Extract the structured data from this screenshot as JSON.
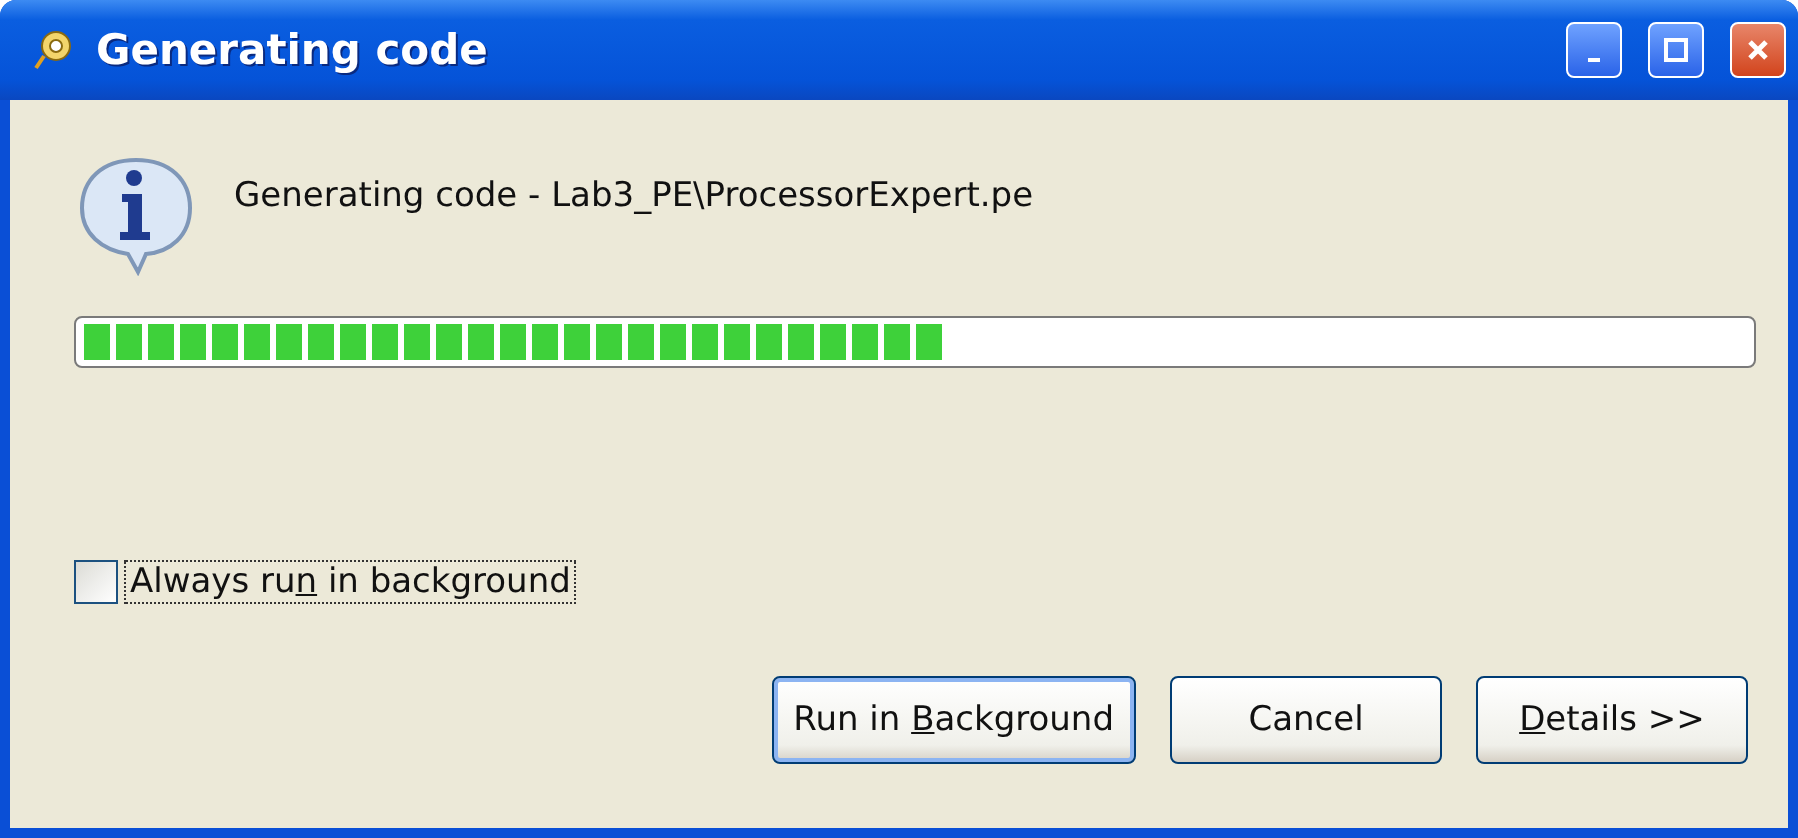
{
  "window": {
    "title": "Generating code"
  },
  "message": "Generating code - Lab3_PE\\ProcessorExpert.pe",
  "progress": {
    "level": 0.52
  },
  "checkbox": {
    "label": {
      "before": "Always ru",
      "access_key": "n",
      "after": " in background"
    },
    "checked": false,
    "focused": true
  },
  "buttons": [
    {
      "label": {
        "before": "Run in ",
        "access_key": "B",
        "after": "ackground"
      },
      "default": true
    },
    {
      "label": {
        "before": "Cancel"
      },
      "default": false
    },
    {
      "label": {
        "access_key": "D",
        "after": "etails >>"
      },
      "default": false
    }
  ]
}
